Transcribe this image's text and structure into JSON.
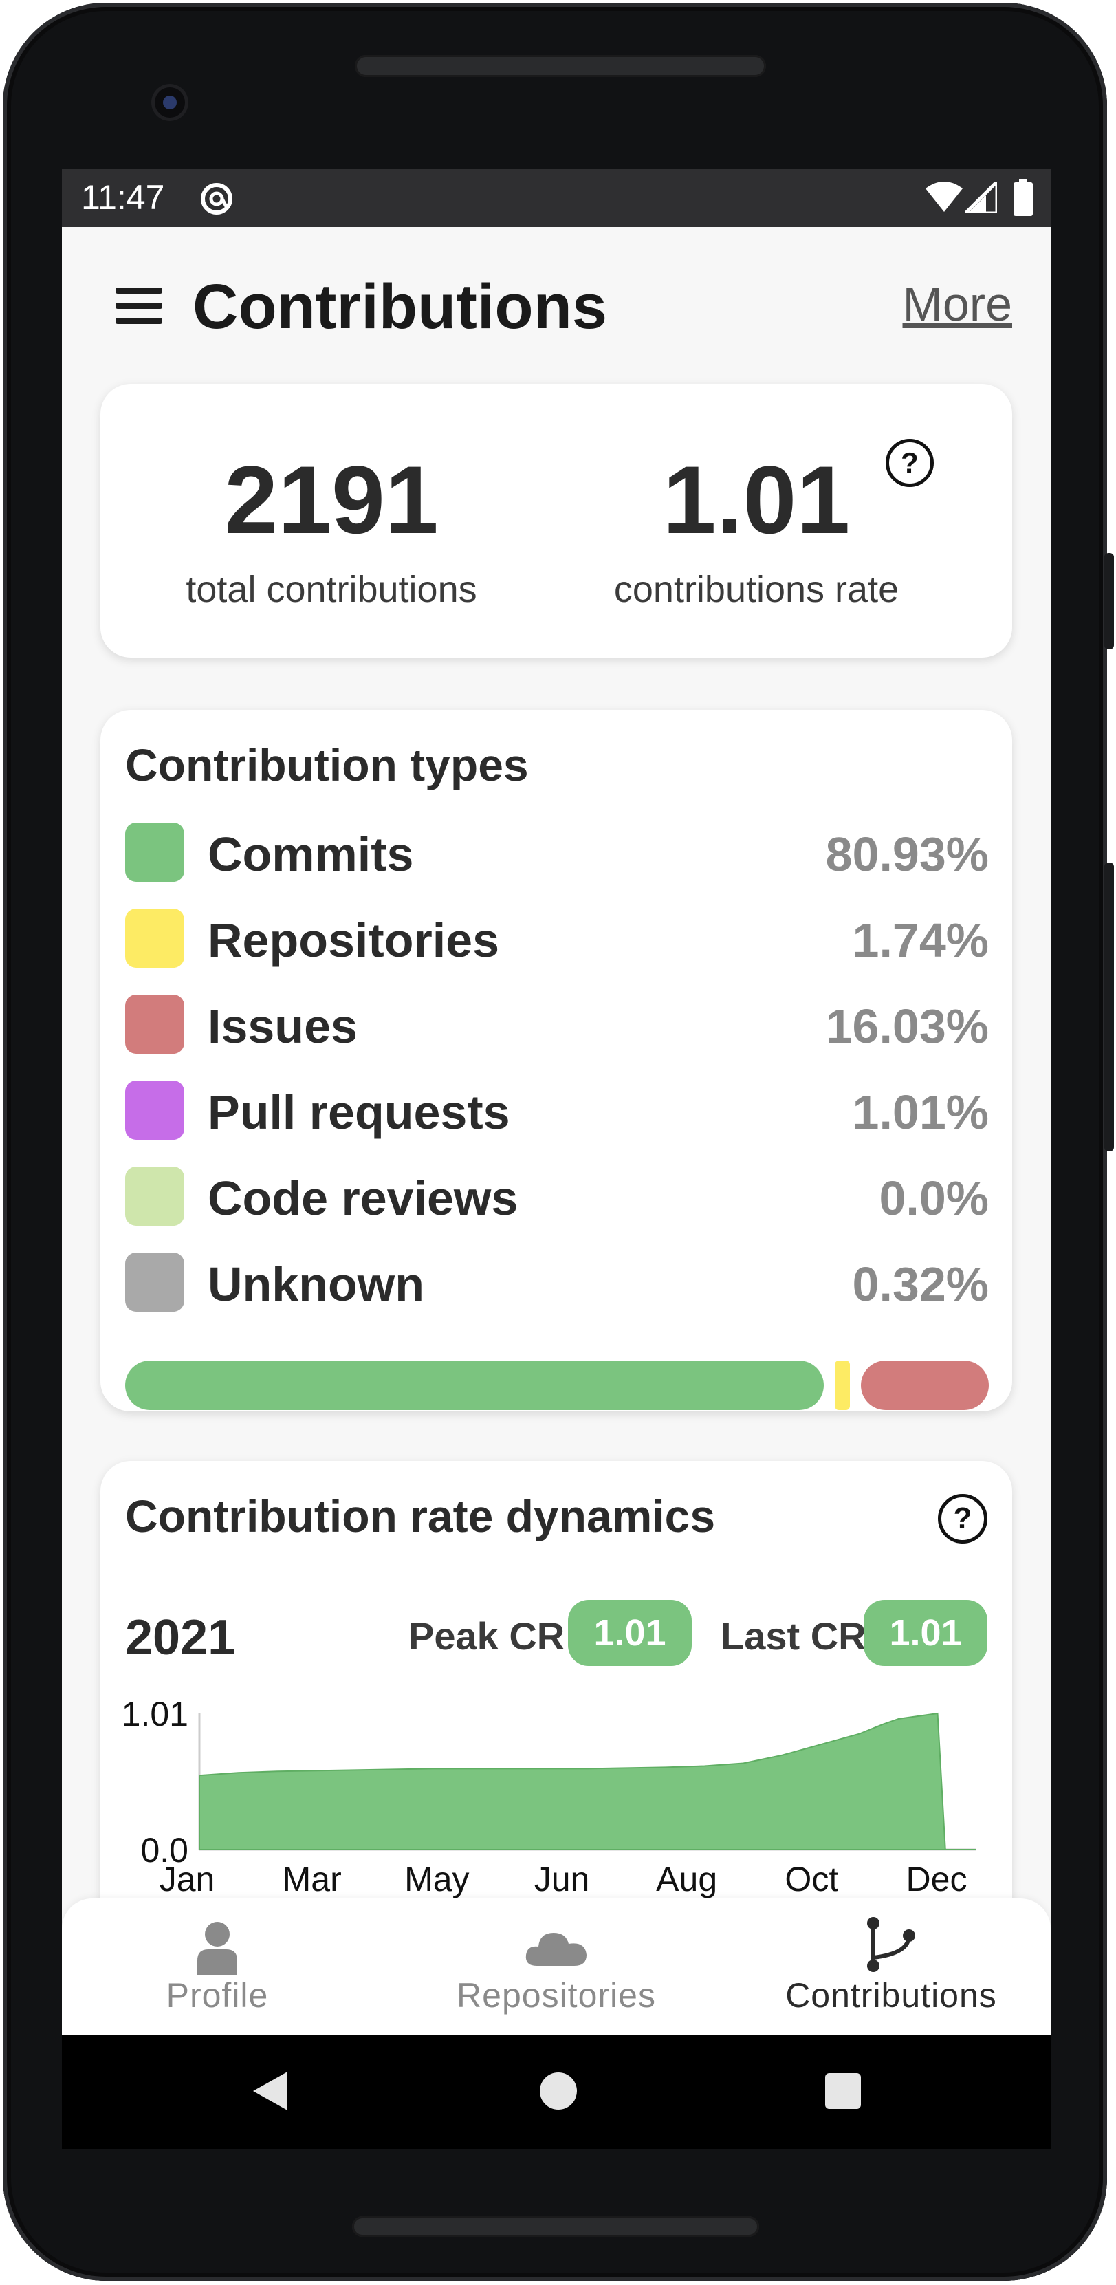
{
  "status_bar": {
    "time": "11:47",
    "icons": [
      "at-sign-icon",
      "wifi-icon",
      "signal-icon",
      "battery-icon"
    ]
  },
  "header": {
    "menu_icon": "menu-icon",
    "title": "Contributions",
    "more_label": "More"
  },
  "summary": {
    "total_value": "2191",
    "total_label": "total contributions",
    "rate_value": "1.01",
    "rate_label": "contributions rate",
    "help_icon": "question-circle-icon"
  },
  "contribution_types": {
    "title": "Contribution types",
    "items": [
      {
        "label": "Commits",
        "value": "80.93%",
        "color": "#7bc47f"
      },
      {
        "label": "Repositories",
        "value": "1.74%",
        "color": "#fdeb64"
      },
      {
        "label": "Issues",
        "value": "16.03%",
        "color": "#d27c7c"
      },
      {
        "label": "Pull requests",
        "value": "1.01%",
        "color": "#c66de8"
      },
      {
        "label": "Code reviews",
        "value": "0.0%",
        "color": "#cfe6ac"
      },
      {
        "label": "Unknown",
        "value": "0.32%",
        "color": "#a9a9a9"
      }
    ]
  },
  "rate_dynamics": {
    "title": "Contribution rate dynamics",
    "year": "2021",
    "peak_label": "Peak CR",
    "peak_value": "1.01",
    "last_label": "Last CR",
    "last_value": "1.01",
    "help_icon": "question-circle-icon"
  },
  "chart_data": {
    "type": "area",
    "title": "",
    "xlabel": "",
    "ylabel": "",
    "x_tick_labels": [
      "Jan",
      "Mar",
      "May",
      "Jun",
      "Aug",
      "Oct",
      "Dec"
    ],
    "y_tick_labels": [
      "1.01",
      "0.0"
    ],
    "ylim": [
      0.0,
      1.01
    ],
    "grid": false,
    "legend": "none",
    "color": "#7bc47f",
    "x": [
      0.0,
      0.05,
      0.1,
      0.2,
      0.3,
      0.4,
      0.5,
      0.6,
      0.65,
      0.7,
      0.75,
      0.8,
      0.85,
      0.88,
      0.9,
      0.95,
      0.96,
      1.0
    ],
    "values": [
      0.55,
      0.57,
      0.58,
      0.59,
      0.6,
      0.6,
      0.6,
      0.61,
      0.62,
      0.64,
      0.7,
      0.78,
      0.86,
      0.93,
      0.97,
      1.01,
      0.0,
      0.0
    ]
  },
  "bottom_nav": {
    "items": [
      {
        "label": "Profile",
        "icon": "person-icon",
        "active": false
      },
      {
        "label": "Repositories",
        "icon": "cloud-icon",
        "active": false
      },
      {
        "label": "Contributions",
        "icon": "branch-icon",
        "active": true
      }
    ]
  },
  "system_nav": {
    "back_icon": "back-triangle-icon",
    "home_icon": "home-circle-icon",
    "recents_icon": "recents-square-icon"
  }
}
